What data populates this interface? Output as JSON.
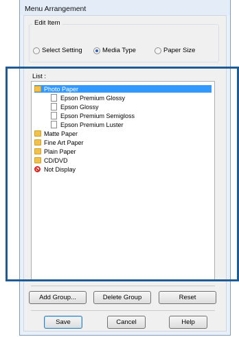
{
  "window": {
    "title": "Menu Arrangement"
  },
  "edit_item": {
    "label": "Edit Item",
    "options": [
      {
        "label": "Select Setting",
        "selected": false
      },
      {
        "label": "Media Type",
        "selected": true
      },
      {
        "label": "Paper Size",
        "selected": false
      }
    ]
  },
  "list": {
    "label": "List :",
    "items": [
      {
        "label": "Photo Paper",
        "icon": "folder-icon",
        "selected": true
      },
      {
        "label": "Epson Premium Glossy",
        "icon": "document-icon",
        "selected": false
      },
      {
        "label": "Epson Glossy",
        "icon": "document-icon",
        "selected": false
      },
      {
        "label": "Epson Premium Semigloss",
        "icon": "document-icon",
        "selected": false
      },
      {
        "label": "Epson Premium Luster",
        "icon": "document-icon",
        "selected": false
      },
      {
        "label": "Matte Paper",
        "icon": "folder-icon",
        "selected": false
      },
      {
        "label": "Fine Art Paper",
        "icon": "folder-icon",
        "selected": false
      },
      {
        "label": "Plain Paper",
        "icon": "folder-icon",
        "selected": false
      },
      {
        "label": "CD/DVD",
        "icon": "folder-icon",
        "selected": false
      },
      {
        "label": "Not Display",
        "icon": "not-display-icon",
        "selected": false
      }
    ]
  },
  "buttons": {
    "add_group": "Add Group...",
    "delete_group": "Delete Group",
    "reset": "Reset",
    "save": "Save",
    "cancel": "Cancel",
    "help": "Help"
  },
  "colors": {
    "selection": "#3399ff",
    "highlight_frame": "#1e5a94",
    "folder": "#f1c14d",
    "not_display": "#d8231f"
  }
}
